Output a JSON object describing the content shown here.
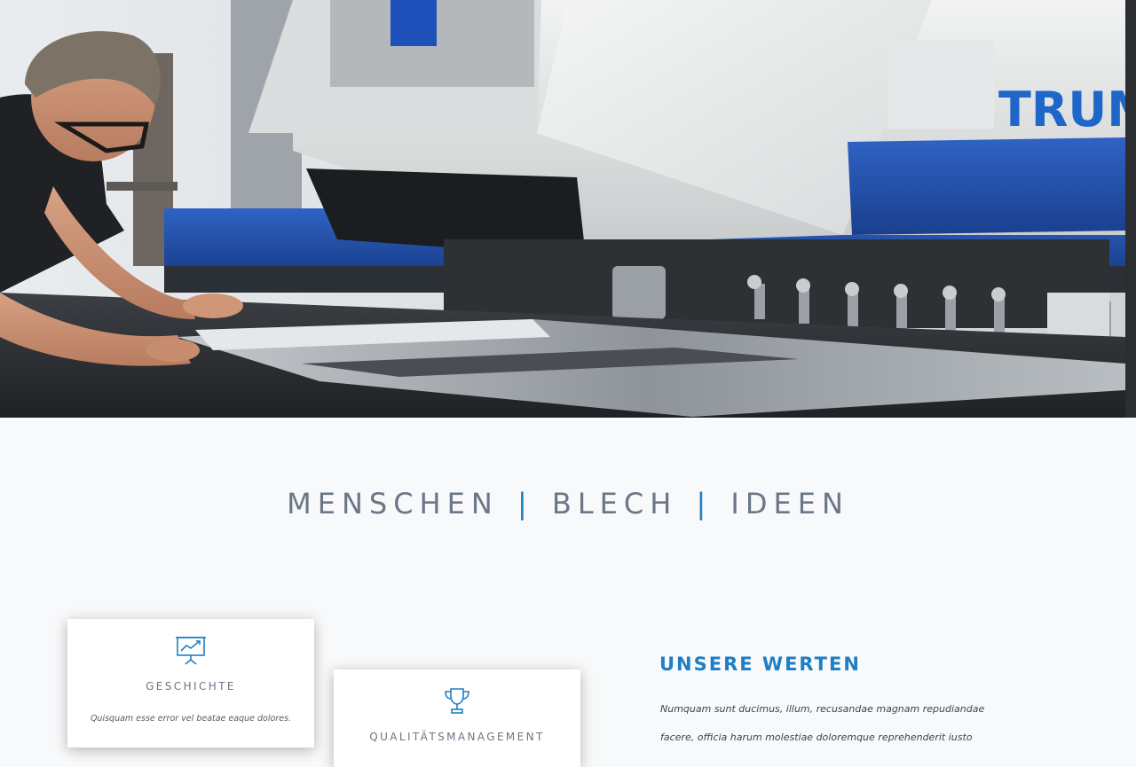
{
  "hero": {
    "machine_brand": "TRUM"
  },
  "tagline": {
    "word1": "MENSCHEN",
    "word2": "BLECH",
    "word3": "IDEEN",
    "separator": "|"
  },
  "cards": [
    {
      "icon": "presentation-chart-icon",
      "title": "GESCHICHTE",
      "text": "Quisquam esse error vel beatae eaque dolores."
    },
    {
      "icon": "trophy-icon",
      "title": "QUALITÄTSMANAGEMENT",
      "text": ""
    }
  ],
  "values": {
    "title": "UNSERE WERTEN",
    "line1": "Numquam sunt ducimus, illum, recusandae magnam repudiandae",
    "line2": "facere, officia harum molestiae doloremque reprehenderit iusto"
  },
  "colors": {
    "accent": "#1f7fc4",
    "heading_gray": "#6b7686",
    "background": "#f8f9fa",
    "machine_blue": "#1d55b8"
  }
}
